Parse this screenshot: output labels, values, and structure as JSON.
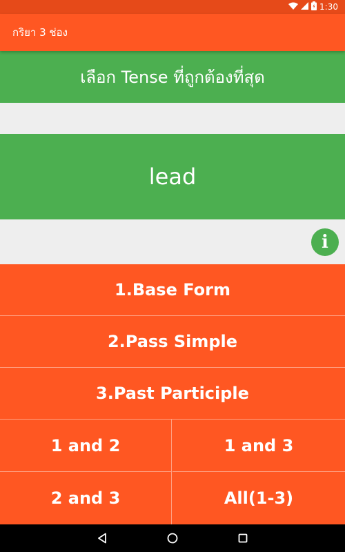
{
  "status_bar": {
    "time": "1:30"
  },
  "app_bar": {
    "title": "กริยา 3 ช่อง"
  },
  "quiz": {
    "question": "เลือก Tense ที่ถูกต้องที่สุด",
    "word": "lead"
  },
  "answers": [
    {
      "label": "1.Base Form"
    },
    {
      "label": "2.Pass Simple"
    },
    {
      "label": "3.Past Participle"
    },
    {
      "label": "1 and 2"
    },
    {
      "label": "1 and 3"
    },
    {
      "label": "2 and 3"
    },
    {
      "label": "All(1-3)"
    }
  ],
  "colors": {
    "primary": "#ff5722",
    "primary_dark": "#e64a19",
    "green": "#4caf50",
    "background": "#eeeeee"
  },
  "icons": {
    "info": "info-icon",
    "wifi": "wifi-icon",
    "signal": "signal-icon",
    "battery": "battery-icon",
    "back": "back-icon",
    "home": "home-icon",
    "recents": "recents-icon"
  }
}
